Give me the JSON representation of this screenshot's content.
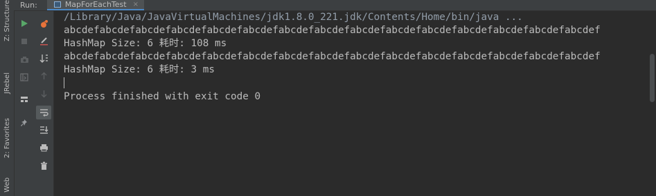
{
  "side_tabs": {
    "structure": "Z: Structure",
    "jrebel": "JRebel",
    "favorites": "2: Favorites",
    "web": "Web"
  },
  "header": {
    "run_label": "Run:",
    "tab_title": "MapForEachTest",
    "tab_close": "×"
  },
  "toolbar": {
    "col1": [
      "rerun-icon",
      "stop-icon",
      "camera-icon",
      "restore-layout-icon",
      "layout-icon",
      "pin-icon"
    ],
    "col2": [
      "debug-rerun-icon",
      "clear-icon",
      "sort-icon",
      "up-arrow-icon",
      "down-arrow-icon",
      "soft-wrap-icon",
      "scroll-to-end-icon",
      "print-icon",
      "trash-icon"
    ]
  },
  "console": {
    "lines": [
      {
        "kind": "cmd",
        "text": "/Library/Java/JavaVirtualMachines/jdk1.8.0_221.jdk/Contents/Home/bin/java ..."
      },
      {
        "kind": "out",
        "text": "abcdefabcdefabcdefabcdefabcdefabcdefabcdefabcdefabcdefabcdefabcdefabcdefabcdefabcdefabcdef"
      },
      {
        "kind": "out",
        "text": "HashMap Size: 6 耗时: 108 ms"
      },
      {
        "kind": "out",
        "text": "abcdefabcdefabcdefabcdefabcdefabcdefabcdefabcdefabcdefabcdefabcdefabcdefabcdefabcdefabcdef"
      },
      {
        "kind": "out",
        "text": "HashMap Size: 6 耗时: 3 ms"
      },
      {
        "kind": "out",
        "text": ""
      },
      {
        "kind": "out",
        "text": "Process finished with exit code 0"
      }
    ]
  },
  "colors": {
    "background": "#2b2b2b",
    "panel": "#3c3f41",
    "text": "#bbbbbb",
    "accent_tab": "#4a88c7",
    "run_green": "#59a869",
    "stop_red": "#c75450",
    "debug_orange": "#e8733a"
  }
}
